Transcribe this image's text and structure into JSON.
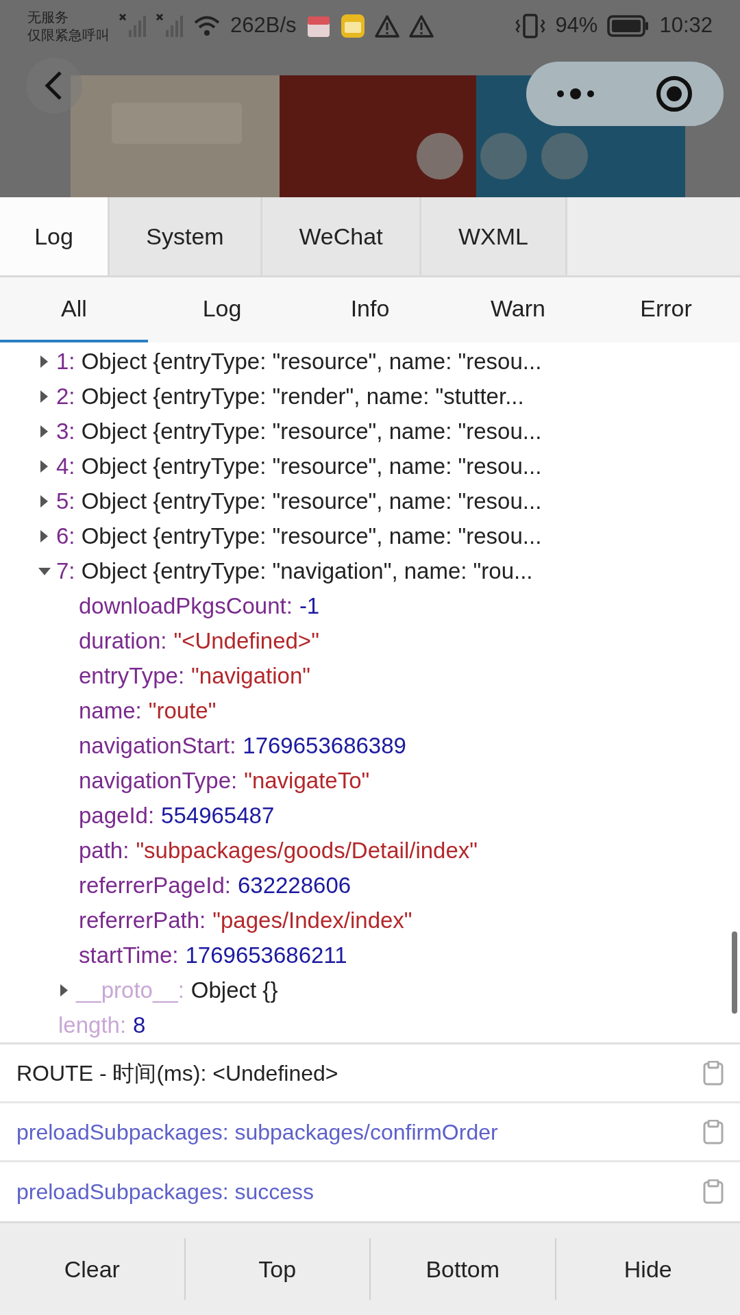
{
  "status_bar": {
    "carrier_line_1": "无服务",
    "carrier_line_2": "仅限紧急呼叫",
    "net_speed": "262B/s",
    "battery": "94%",
    "time": "10:32"
  },
  "header": {
    "kind": "picture"
  },
  "panel_tabs": [
    {
      "label": "Log",
      "selected": true
    },
    {
      "label": "System",
      "selected": false
    },
    {
      "label": "WeChat",
      "selected": false
    },
    {
      "label": "WXML",
      "selected": false
    }
  ],
  "level_tabs": [
    {
      "label": "All",
      "selected": true
    },
    {
      "label": "Log",
      "selected": false
    },
    {
      "label": "Info",
      "selected": false
    },
    {
      "label": "Warn",
      "selected": false
    },
    {
      "label": "Error",
      "selected": false
    }
  ],
  "entries": [
    {
      "index": "1:",
      "expanded": false,
      "summary": "Object {entryType: \"resource\", name: \"resou..."
    },
    {
      "index": "2:",
      "expanded": false,
      "summary": "Object {entryType: \"render\", name: \"stutter..."
    },
    {
      "index": "3:",
      "expanded": false,
      "summary": "Object {entryType: \"resource\", name: \"resou..."
    },
    {
      "index": "4:",
      "expanded": false,
      "summary": "Object {entryType: \"resource\", name: \"resou..."
    },
    {
      "index": "5:",
      "expanded": false,
      "summary": "Object {entryType: \"resource\", name: \"resou..."
    },
    {
      "index": "6:",
      "expanded": false,
      "summary": "Object {entryType: \"resource\", name: \"resou..."
    },
    {
      "index": "7:",
      "expanded": true,
      "summary": "Object {entryType: \"navigation\", name: \"rou...",
      "properties": [
        {
          "key": "downloadPkgsCount:",
          "value": "-1",
          "kind": "number"
        },
        {
          "key": "duration:",
          "value": "\"<Undefined>\"",
          "kind": "string"
        },
        {
          "key": "entryType:",
          "value": "\"navigation\"",
          "kind": "string"
        },
        {
          "key": "name:",
          "value": "\"route\"",
          "kind": "string"
        },
        {
          "key": "navigationStart:",
          "value": "1769653686389",
          "kind": "number"
        },
        {
          "key": "navigationType:",
          "value": "\"navigateTo\"",
          "kind": "string"
        },
        {
          "key": "pageId:",
          "value": "554965487",
          "kind": "number"
        },
        {
          "key": "path:",
          "value": "\"subpackages/goods/Detail/index\"",
          "kind": "string"
        },
        {
          "key": "referrerPageId:",
          "value": "632228606",
          "kind": "number"
        },
        {
          "key": "referrerPath:",
          "value": "\"pages/Index/index\"",
          "kind": "string"
        },
        {
          "key": "startTime:",
          "value": "1769653686211",
          "kind": "number"
        },
        {
          "key": "__proto__:",
          "value": "Object {}",
          "kind": "object",
          "expanded": false
        }
      ]
    }
  ],
  "length": {
    "key": "length:",
    "value": "8"
  },
  "log_rows": [
    {
      "text": "ROUTE - 时间(ms): <Undefined>",
      "kind": "log"
    },
    {
      "text": "preloadSubpackages: subpackages/confirmOrder",
      "kind": "info"
    },
    {
      "text": "preloadSubpackages: success",
      "kind": "info"
    }
  ],
  "buttons": [
    "Clear",
    "Top",
    "Bottom",
    "Hide"
  ]
}
